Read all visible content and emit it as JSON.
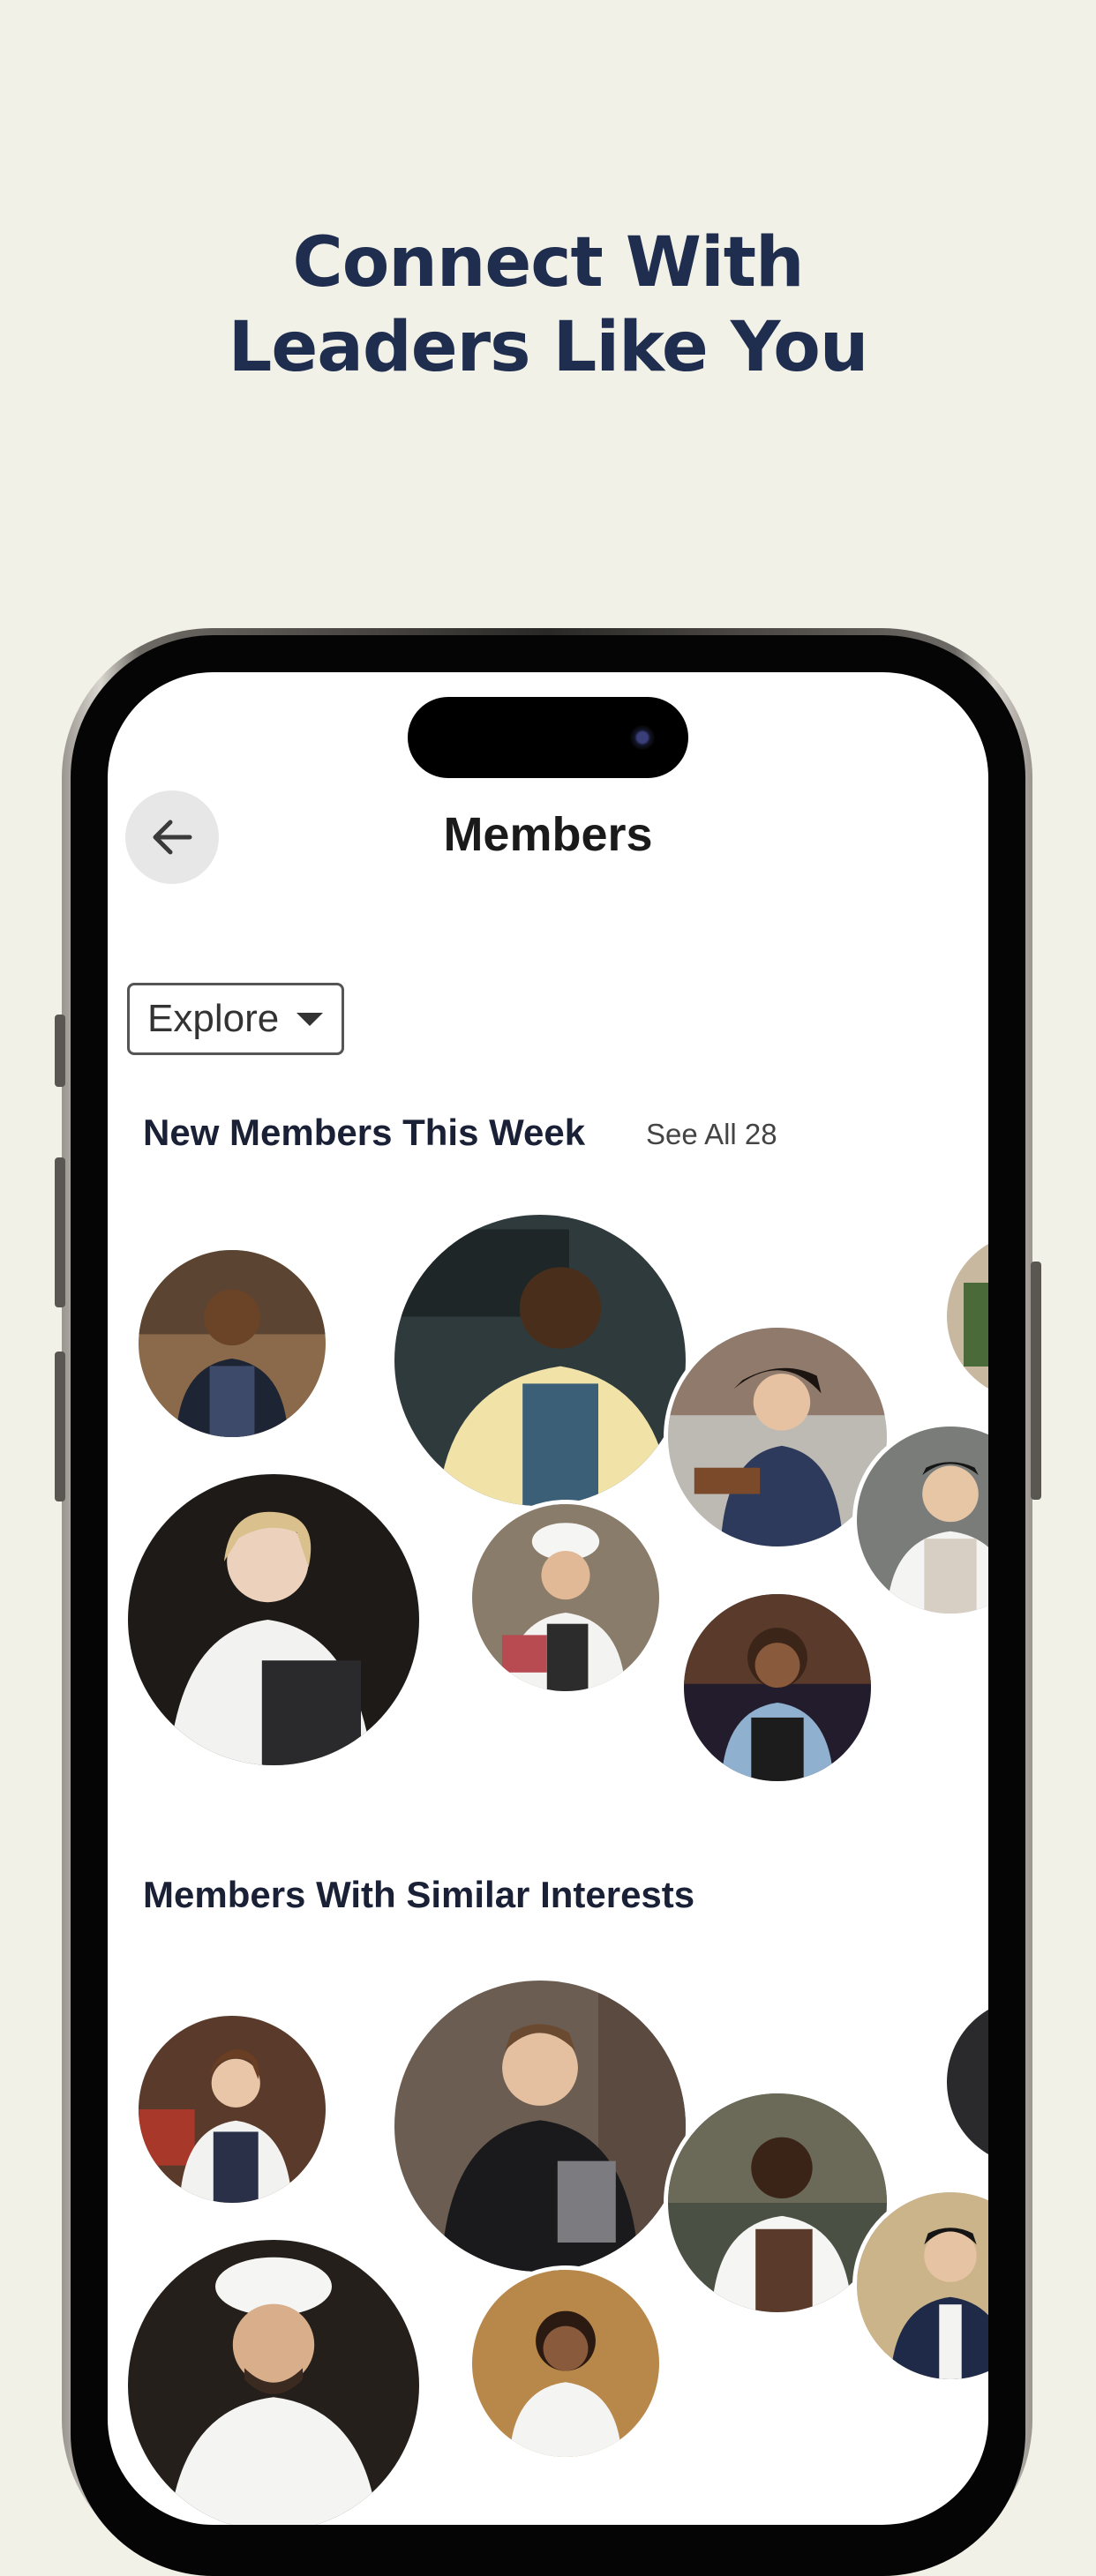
{
  "promo": {
    "headline_line1": "Connect With",
    "headline_line2": "Leaders Like You"
  },
  "header": {
    "back_icon": "arrow-left-icon",
    "title": "Members"
  },
  "filter": {
    "selected": "Explore",
    "icon": "caret-down-icon"
  },
  "sections": [
    {
      "title": "New Members This Week",
      "see_all_label": "See All 28"
    },
    {
      "title": "Members With Similar Interests"
    }
  ],
  "colors": {
    "background": "#f2f1e8",
    "headline": "#1f2d4e",
    "screen": "#ffffff",
    "back_button_bg": "#e7e7e7"
  }
}
